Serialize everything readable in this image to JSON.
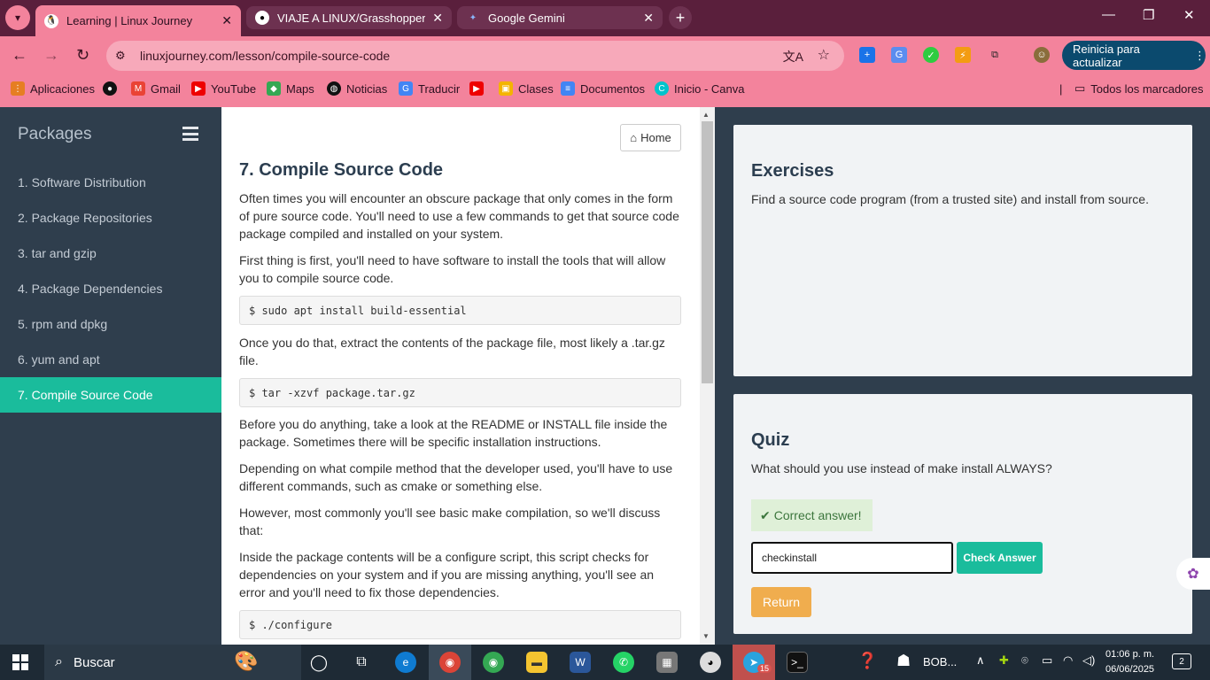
{
  "browser": {
    "tabs": [
      {
        "title": "Learning | Linux Journey",
        "active": true
      },
      {
        "title": "VIAJE A LINUX/Grasshopper/Us",
        "active": false
      },
      {
        "title": "Google Gemini",
        "active": false
      }
    ],
    "url": "linuxjourney.com/lesson/compile-source-code",
    "update_button": "Reinicia para actualizar",
    "bookmarks": [
      "Aplicaciones",
      "Gmail",
      "YouTube",
      "Maps",
      "Noticias",
      "Traducir",
      "Clases",
      "Documentos",
      "Inicio - Canva"
    ],
    "all_bookmarks": "Todos los marcadores"
  },
  "sidebar": {
    "title": "Packages",
    "items": [
      "1. Software Distribution",
      "2. Package Repositories",
      "3. tar and gzip",
      "4. Package Dependencies",
      "5. rpm and dpkg",
      "6. yum and apt",
      "7. Compile Source Code"
    ],
    "active_index": 6
  },
  "lesson": {
    "home_label": "Home",
    "title": "7. Compile Source Code",
    "p1": "Often times you will encounter an obscure package that only comes in the form of pure source code. You'll need to use a few commands to get that source code package compiled and installed on your system.",
    "p2": "First thing is first, you'll need to have software to install the tools that will allow you to compile source code.",
    "code1": "$ sudo apt install build-essential",
    "p3": "Once you do that, extract the contents of the package file, most likely a .tar.gz file.",
    "code2": "$ tar -xzvf package.tar.gz",
    "p4": "Before you do anything, take a look at the README or INSTALL file inside the package. Sometimes there will be specific installation instructions.",
    "p5": "Depending on what compile method that the developer used, you'll have to use different commands, such as cmake or something else.",
    "p6": "However, most commonly you'll see basic make compilation, so we'll discuss that:",
    "p7": "Inside the package contents will be a configure script, this script checks for dependencies on your system and if you are missing anything, you'll see an error and you'll need to fix those dependencies.",
    "code3": "$ ./configure"
  },
  "exercises": {
    "title": "Exercises",
    "text": "Find a source code program (from a trusted site) and install from source."
  },
  "quiz": {
    "title": "Quiz",
    "question": "What should you use instead of make install ALWAYS?",
    "feedback": "Correct answer!",
    "answer_value": "checkinstall",
    "check_label": "Check Answer",
    "return_label": "Return"
  },
  "taskbar": {
    "search_label": "Buscar",
    "tray_app_label": "BOB...",
    "badge_count": "15",
    "time": "01:06 p. m.",
    "date": "06/06/2025",
    "notifications": "2"
  },
  "colors": {
    "accent_teal": "#1abc9c",
    "warning_orange": "#f0ad4e",
    "browser_pink": "#f3839c",
    "sidebar_dark": "#2f3e4d"
  }
}
